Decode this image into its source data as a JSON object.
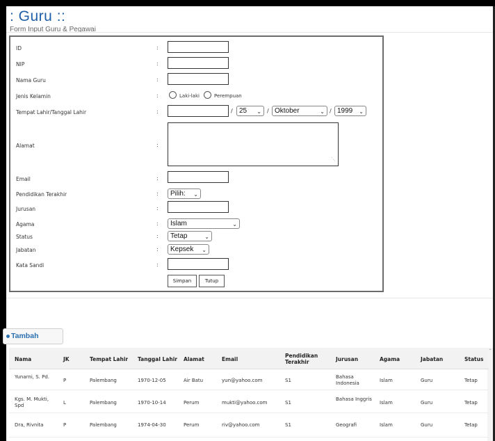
{
  "header": {
    "title": ": Guru ::",
    "subtitle": "Form Input Guru & Pegawai"
  },
  "form": {
    "colon": ":",
    "labels": {
      "id": "ID",
      "nip": "NIP",
      "nama": "Nama Guru",
      "jk": "Jenis Kelamin",
      "ttl": "Tempat Lahir/Tanggal Lahir",
      "alamat": "Alamat",
      "email": "Email",
      "pendidikan": "Pendidikan Terakhir",
      "jurusan": "Jurusan",
      "agama": "Agama",
      "status": "Status",
      "jabatan": "Jabatan",
      "sandi": "Kata Sandi"
    },
    "gender_options": [
      "Laki-laki",
      "Perempuan"
    ],
    "birth": {
      "day": "25",
      "month": "Oktober",
      "year": "1999",
      "sep": "/"
    },
    "selects": {
      "pendidikan": "Pilih:",
      "agama": "Islam",
      "status": "Tetap",
      "jabatan": "Kepsek"
    },
    "buttons": {
      "save": "Simpan",
      "close": "Tutup"
    }
  },
  "tambah_label": "Tambah",
  "table": {
    "headers": [
      "Nama",
      "JK",
      "Tempat Lahir",
      "Tanggal Lahir",
      "Alamat",
      "Email",
      "Pendidikan Terakhir",
      "Jurusan",
      "Agama",
      "Jabatan",
      "Status"
    ],
    "rows": [
      [
        "Yunarni, S. Pd.",
        "P",
        "Palembang",
        "1970-12-05",
        "Air Batu",
        "yun@yahoo.com",
        "S1",
        "Bahasa Indonesia",
        "Islam",
        "Guru",
        "Tetap"
      ],
      [
        "Kgs. M. Mukti, Spd",
        "L",
        "Palembang",
        "1970-10-14",
        "Perum",
        "mukti@yahoo.com",
        "S1",
        "Bahasa Inggris",
        "Islam",
        "Guru",
        "Tetap"
      ],
      [
        "Dra, Rivnita",
        "P",
        "Palembang",
        "1974-04-30",
        "Perum",
        "riv@yahoo.com",
        "S1",
        "Geografi",
        "Islam",
        "Guru",
        "Tetap"
      ]
    ]
  },
  "icons": {
    "dropdown": "chevron-down-icon",
    "add": "plus-icon",
    "resize": "resize-grip-icon",
    "scroll": "scroll-up-icon"
  }
}
